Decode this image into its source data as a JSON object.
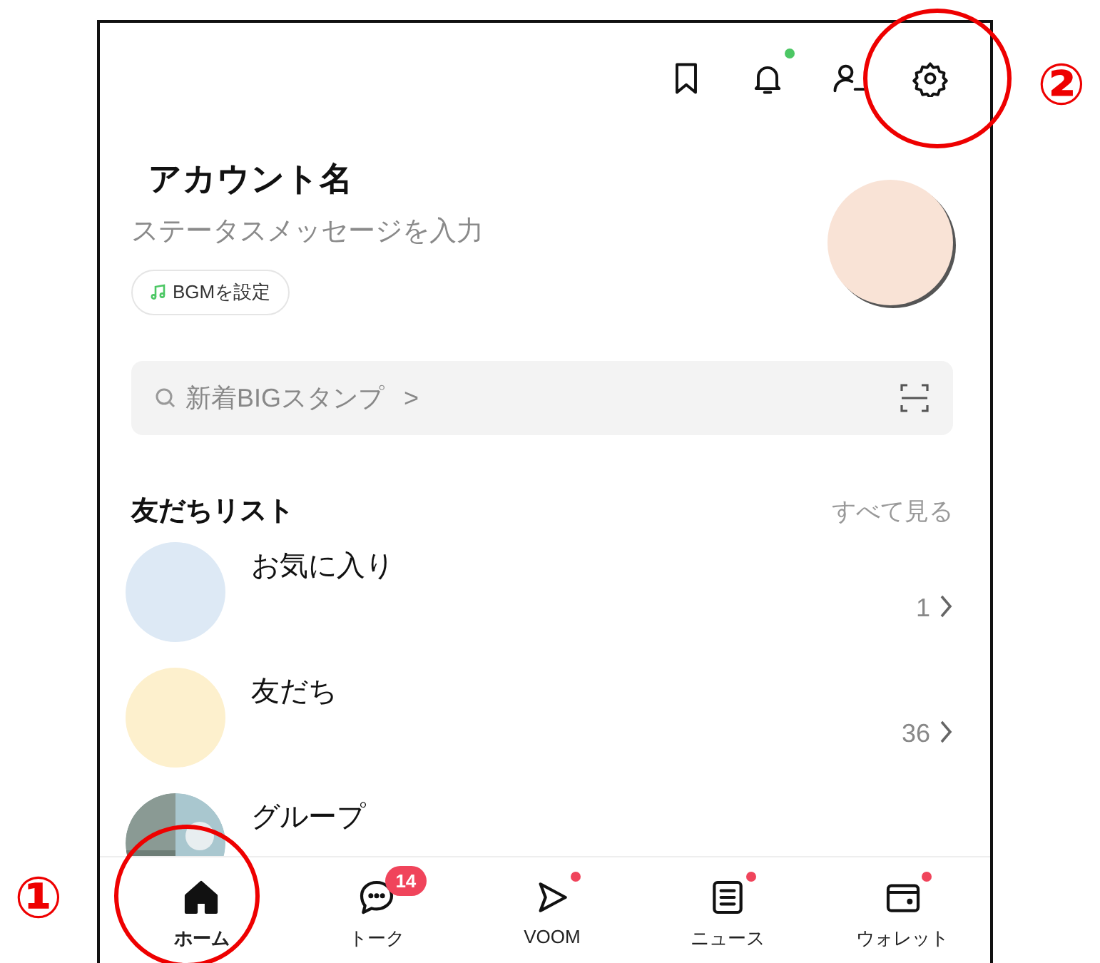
{
  "header_icons": [
    {
      "kind": "bookmark",
      "dot": false
    },
    {
      "kind": "bell",
      "dot": true
    },
    {
      "kind": "add-friend",
      "dot": false
    },
    {
      "kind": "settings",
      "dot": false
    }
  ],
  "profile": {
    "name": "アカウント名",
    "status_placeholder": "ステータスメッセージを入力",
    "bgm_button": "BGMを設定"
  },
  "search": {
    "placeholder": "新着BIGスタンプ",
    "chevron": ">"
  },
  "friends_section": {
    "title": "友だちリスト",
    "see_all": "すべて見る"
  },
  "friends_list": [
    {
      "kind": "circle",
      "color": "#dde9f5",
      "name": "お気に入り",
      "count": "1"
    },
    {
      "kind": "circle",
      "color": "#fdf0cd",
      "name": "友だち",
      "count": "36"
    },
    {
      "kind": "picture",
      "name": "グループ"
    }
  ],
  "bottom_nav": [
    {
      "kind": "home",
      "label": "ホーム",
      "selected": true,
      "dot": false
    },
    {
      "kind": "chat",
      "label": "トーク",
      "selected": false,
      "badge": "14",
      "dot": false
    },
    {
      "kind": "voom",
      "label": "VOOM",
      "selected": false,
      "dot": true
    },
    {
      "kind": "news",
      "label": "ニュース",
      "selected": false,
      "dot": true
    },
    {
      "kind": "wallet",
      "label": "ウォレット",
      "selected": false,
      "dot": true
    }
  ],
  "annotations": [
    {
      "label": "①"
    },
    {
      "label": "②"
    }
  ]
}
